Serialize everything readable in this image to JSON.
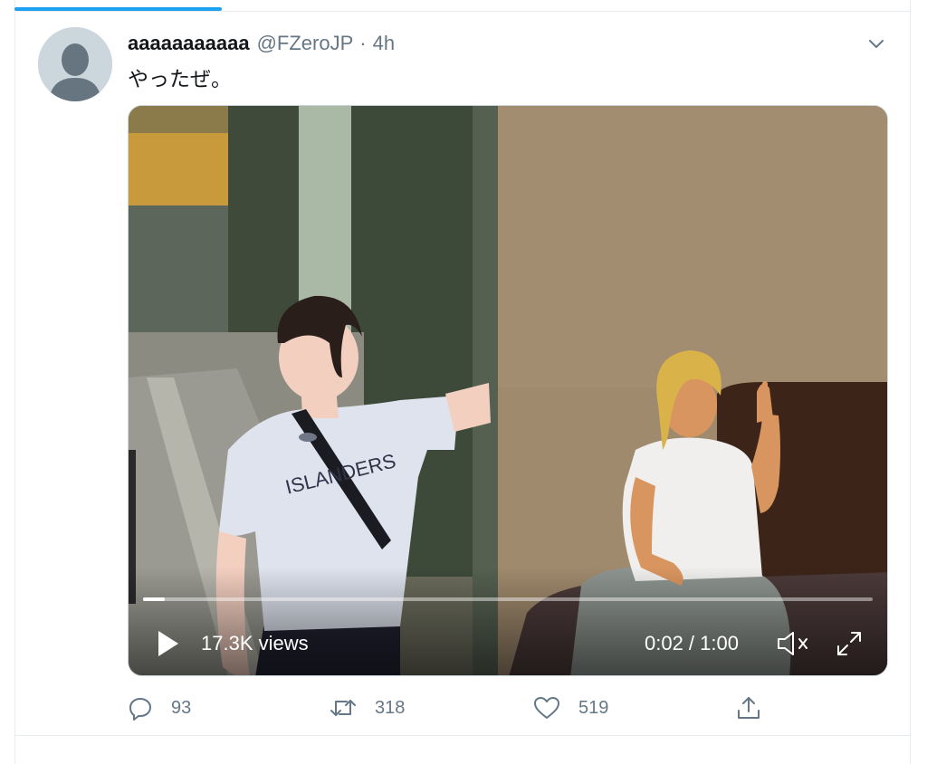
{
  "tweet": {
    "author": {
      "display_name": "aaaaaaaaaaa",
      "handle": "@FZeroJP"
    },
    "separator": "·",
    "time": "4h",
    "text": "やったぜ。",
    "media": {
      "views": "17.3K views",
      "time_readout": "0:02 / 1:00",
      "progress": 0.03,
      "shirt_text": "ISLANDERS"
    },
    "actions": {
      "reply_count": "93",
      "retweet_count": "318",
      "like_count": "519"
    }
  },
  "icons": {
    "menu": "chevron-down-icon",
    "play": "play-icon",
    "mute": "muted-speaker-icon",
    "fullscreen": "expand-icon",
    "reply": "reply-icon",
    "retweet": "retweet-icon",
    "like": "heart-icon",
    "share": "share-icon"
  },
  "colors": {
    "accent": "#1da1f2",
    "secondary_text": "#657786",
    "divider": "#e6ecf0"
  }
}
